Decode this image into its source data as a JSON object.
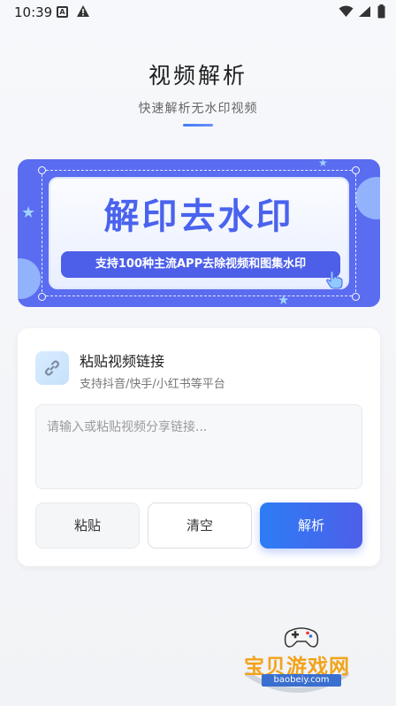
{
  "status_bar": {
    "time": "10:39",
    "notification_letter": "A"
  },
  "header": {
    "title": "视频解析",
    "subtitle": "快速解析无水印视频"
  },
  "banner": {
    "headline": "解印去水印",
    "tagline": "支持100种主流APP去除视频和图集水印"
  },
  "card": {
    "title": "粘贴视频链接",
    "subtitle": "支持抖音/快手/小红书等平台",
    "input": {
      "value": "",
      "placeholder": "请输入或粘贴视频分享链接..."
    },
    "buttons": {
      "paste": "粘贴",
      "clear": "清空",
      "parse": "解析"
    }
  },
  "watermark": {
    "text": "宝贝游戏网",
    "url": "baobeiy.com"
  },
  "colors": {
    "accent": "#4a63ee",
    "banner_bg": "#5a6cf0",
    "parse_button_start": "#2c7df5",
    "watermark_orange": "#f2a31a"
  },
  "icons": [
    "warning-icon",
    "wifi-icon",
    "signal-icon",
    "battery-icon",
    "link-icon",
    "star-icon",
    "hand-cursor-icon",
    "gamepad-icon"
  ]
}
